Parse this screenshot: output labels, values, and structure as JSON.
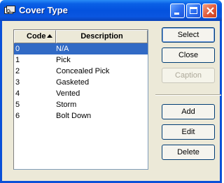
{
  "window": {
    "title": "Cover Type",
    "title_icon": "app-icon",
    "controls": {
      "minimize": "minimize-icon",
      "maximize": "maximize-icon",
      "close": "close-icon"
    }
  },
  "list": {
    "columns": {
      "code": "Code",
      "description": "Description"
    },
    "sort": {
      "column": "code",
      "direction": "ascending"
    },
    "rows": [
      {
        "code": "0",
        "description": "N/A"
      },
      {
        "code": "1",
        "description": "Pick"
      },
      {
        "code": "2",
        "description": "Concealed Pick"
      },
      {
        "code": "3",
        "description": "Gasketed"
      },
      {
        "code": "4",
        "description": "Vented"
      },
      {
        "code": "5",
        "description": "Storm"
      },
      {
        "code": "6",
        "description": "Bolt Down"
      }
    ],
    "selected_index": 0
  },
  "buttons": {
    "select": "Select",
    "close": "Close",
    "caption": "Caption",
    "add": "Add",
    "edit": "Edit",
    "delete": "Delete"
  },
  "colors": {
    "titlebar": "#0452de",
    "selection": "#316ac5",
    "face": "#ece9d8"
  }
}
